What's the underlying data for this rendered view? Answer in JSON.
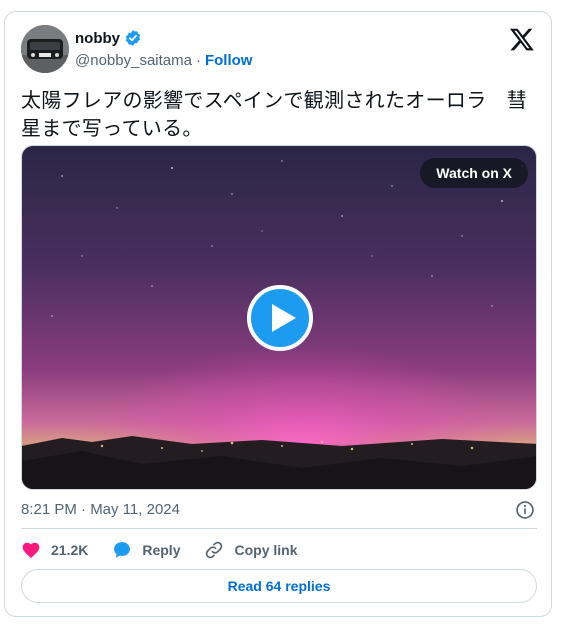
{
  "author": {
    "display_name": "nobby",
    "handle": "@nobby_saitama",
    "separator": "·",
    "follow_label": "Follow",
    "verified": true
  },
  "tweet": {
    "text_line1": "太陽フレアの影響でスペインで観測されたオーロラ　彗",
    "text_line2": "星まで写っている。",
    "timestamp": "8:21 PM · May 11, 2024"
  },
  "media": {
    "watch_label": "Watch on X",
    "play_icon": "play-icon"
  },
  "actions": {
    "likes_count": "21.2K",
    "reply_label": "Reply",
    "copy_link_label": "Copy link"
  },
  "replies_button": "Read 64 replies",
  "colors": {
    "accent": "#006fd6",
    "verified": "#1d9bf0",
    "heart": "#f91880",
    "reply_bubble": "#1d9bf0",
    "secondary_text": "#536471",
    "border": "#cfd9de"
  }
}
